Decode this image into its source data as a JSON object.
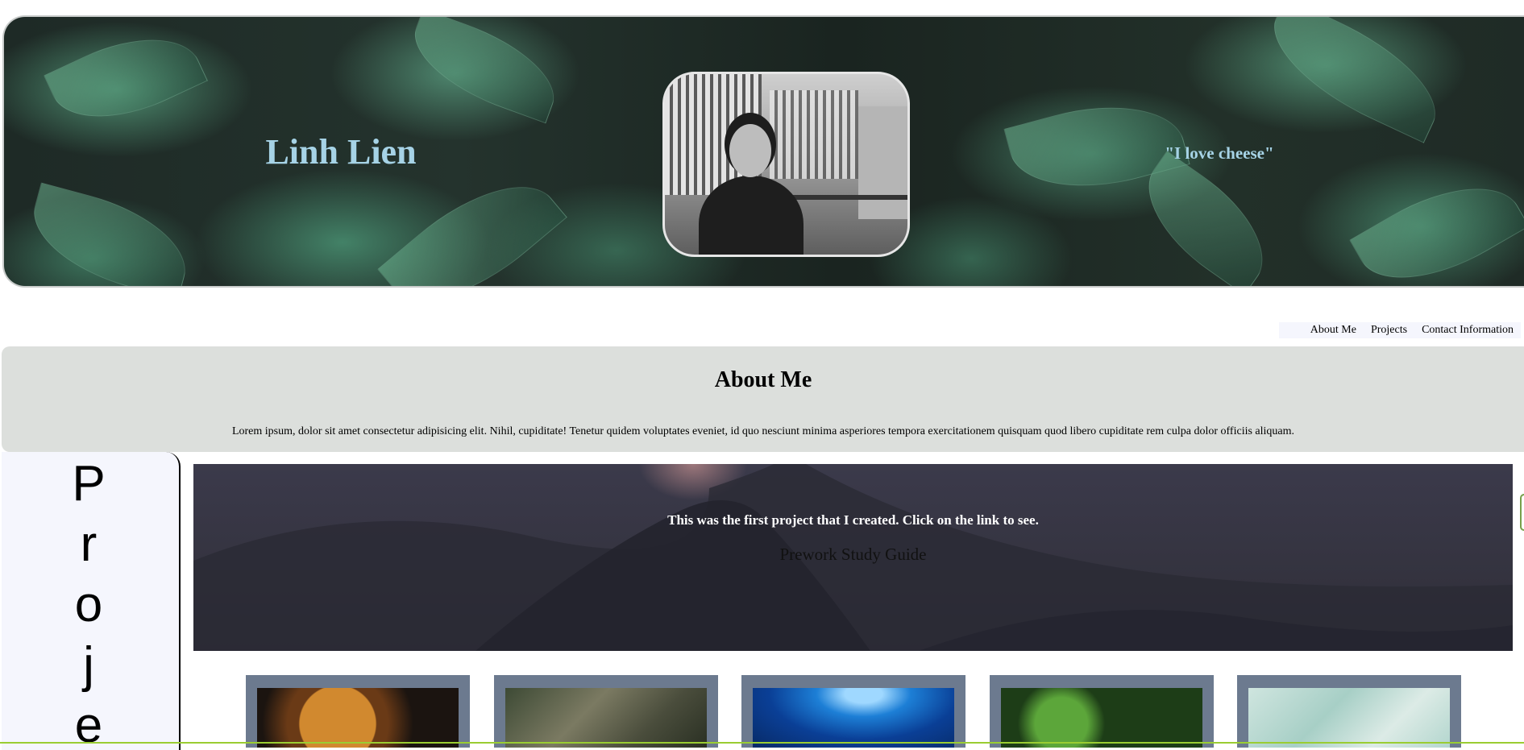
{
  "header": {
    "name": "Linh Lien",
    "quote": "\"I love cheese\""
  },
  "nav": {
    "items": [
      {
        "label": "About Me"
      },
      {
        "label": "Projects"
      },
      {
        "label": "Contact Information"
      }
    ]
  },
  "about": {
    "title": "About Me",
    "body": "Lorem ipsum, dolor sit amet consectetur adipisicing elit. Nihil, cupiditate! Tenetur quidem voluptates eveniet, id quo nesciunt minima asperiores tempora exercitationem quisquam quod libero cupiditate rem culpa dolor officiis aliquam."
  },
  "projects": {
    "sidebar_letters": [
      "P",
      "r",
      "o",
      "j",
      "e"
    ],
    "feature_text": "This was the first project that I created. Click on the link to see.",
    "feature_link": "Prework Study Guide"
  },
  "colors": {
    "accent_text": "#a6d3e6",
    "about_bg": "#dcdfdc",
    "sidebar_bg": "#f5f6fd",
    "thumb_frame": "#6c7a8f"
  }
}
